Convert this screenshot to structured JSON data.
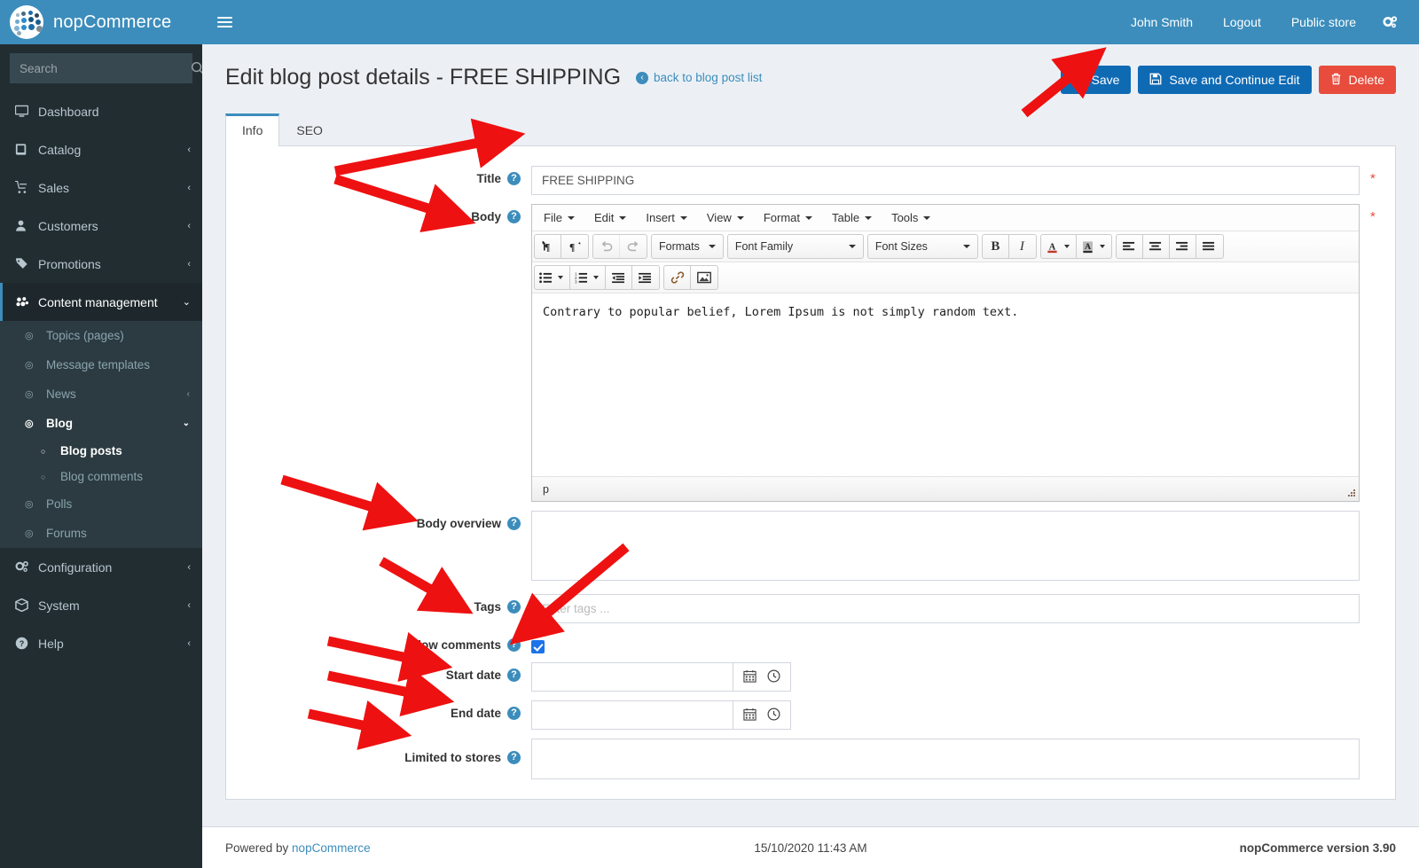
{
  "brand": {
    "name": "nopCommerce",
    "logo_icon": "nopcommerce-dots-logo"
  },
  "sidebar": {
    "search_placeholder": "Search",
    "search_icon": "search-icon",
    "items": [
      {
        "label": "Dashboard",
        "icon": "monitor-icon",
        "arrow": ""
      },
      {
        "label": "Catalog",
        "icon": "book-icon",
        "arrow": "‹"
      },
      {
        "label": "Sales",
        "icon": "cart-icon",
        "arrow": "‹"
      },
      {
        "label": "Customers",
        "icon": "user-icon",
        "arrow": "‹"
      },
      {
        "label": "Promotions",
        "icon": "tag-icon",
        "arrow": "‹"
      },
      {
        "label": "Content management",
        "icon": "cubes-icon",
        "arrow": "⌄"
      },
      {
        "label": "Configuration",
        "icon": "cogs-icon",
        "arrow": "‹"
      },
      {
        "label": "System",
        "icon": "box-icon",
        "arrow": "‹"
      },
      {
        "label": "Help",
        "icon": "question-circle-icon",
        "arrow": "‹"
      }
    ],
    "content_management_children": [
      {
        "label": "Topics (pages)",
        "icon": "dot-circle-icon",
        "arrow": ""
      },
      {
        "label": "Message templates",
        "icon": "dot-circle-icon",
        "arrow": ""
      },
      {
        "label": "News",
        "icon": "dot-circle-icon",
        "arrow": "‹"
      },
      {
        "label": "Blog",
        "icon": "dot-circle-icon",
        "arrow": "⌄"
      },
      {
        "label": "Polls",
        "icon": "dot-circle-icon",
        "arrow": ""
      },
      {
        "label": "Forums",
        "icon": "dot-circle-icon",
        "arrow": ""
      }
    ],
    "blog_children": [
      {
        "label": "Blog posts",
        "icon": "circle-o-icon"
      },
      {
        "label": "Blog comments",
        "icon": "circle-o-icon"
      }
    ]
  },
  "topbar": {
    "menu_toggle_icon": "hamburger-icon",
    "user_name": "John Smith",
    "logout_label": "Logout",
    "public_store_label": "Public store",
    "settings_icon": "cogs-icon"
  },
  "header": {
    "title": "Edit blog post details - FREE SHIPPING",
    "back_link": "back to blog post list",
    "back_icon": "arrow-circle-left-icon",
    "buttons": [
      {
        "label": "Save",
        "icon": "floppy-save-icon",
        "style": "primary"
      },
      {
        "label": "Save and Continue Edit",
        "icon": "floppy-save-icon",
        "style": "primary"
      },
      {
        "label": "Delete",
        "icon": "trash-icon",
        "style": "danger"
      }
    ]
  },
  "tabs": [
    {
      "label": "Info",
      "active": true
    },
    {
      "label": "SEO",
      "active": false
    }
  ],
  "form": {
    "title": {
      "label": "Title",
      "value": "FREE SHIPPING",
      "required_mark": "*"
    },
    "body": {
      "label": "Body",
      "required_mark": "*",
      "content": "Contrary to popular belief, Lorem Ipsum is not simply random text.",
      "status_path": "p"
    },
    "body_overview": {
      "label": "Body overview",
      "value": ""
    },
    "tags": {
      "label": "Tags",
      "placeholder": "Enter tags ...",
      "value": ""
    },
    "allow_comments": {
      "label": "Allow comments",
      "checked": true
    },
    "start_date": {
      "label": "Start date",
      "value": "",
      "calendar_icon": "calendar-icon",
      "clock_icon": "clock-icon"
    },
    "end_date": {
      "label": "End date",
      "value": "",
      "calendar_icon": "calendar-icon",
      "clock_icon": "clock-icon"
    },
    "limited_to_stores": {
      "label": "Limited to stores",
      "value": ""
    }
  },
  "editor": {
    "menubar": [
      "File",
      "Edit",
      "Insert",
      "View",
      "Format",
      "Table",
      "Tools"
    ],
    "toolbar_row1": [
      {
        "name": "ltr-paragraph-icon",
        "glyph": "¶"
      },
      {
        "name": "rtl-paragraph-icon",
        "glyph": "¶"
      },
      {
        "name": "undo-icon",
        "glyph": "↶"
      },
      {
        "name": "redo-icon",
        "glyph": "↷"
      }
    ],
    "formats_label": "Formats",
    "font_family_label": "Font Family",
    "font_sizes_label": "Font Sizes",
    "bold_label": "B",
    "italic_label": "I",
    "toolbar_row2": [
      {
        "name": "bullet-list-icon"
      },
      {
        "name": "numbered-list-icon"
      },
      {
        "name": "outdent-icon"
      },
      {
        "name": "indent-icon"
      },
      {
        "name": "link-icon"
      },
      {
        "name": "image-icon"
      }
    ]
  },
  "footer": {
    "powered_by_prefix": "Powered by ",
    "powered_by_link": "nopCommerce",
    "datetime": "15/10/2020 11:43 AM",
    "version": "nopCommerce version 3.90"
  },
  "colors": {
    "brand_blue": "#3c8dbc",
    "sidebar_dark": "#222d32",
    "primary_button": "#0f6ab4",
    "danger_button": "#e74c3c",
    "annotation_arrow": "#ee1111"
  }
}
